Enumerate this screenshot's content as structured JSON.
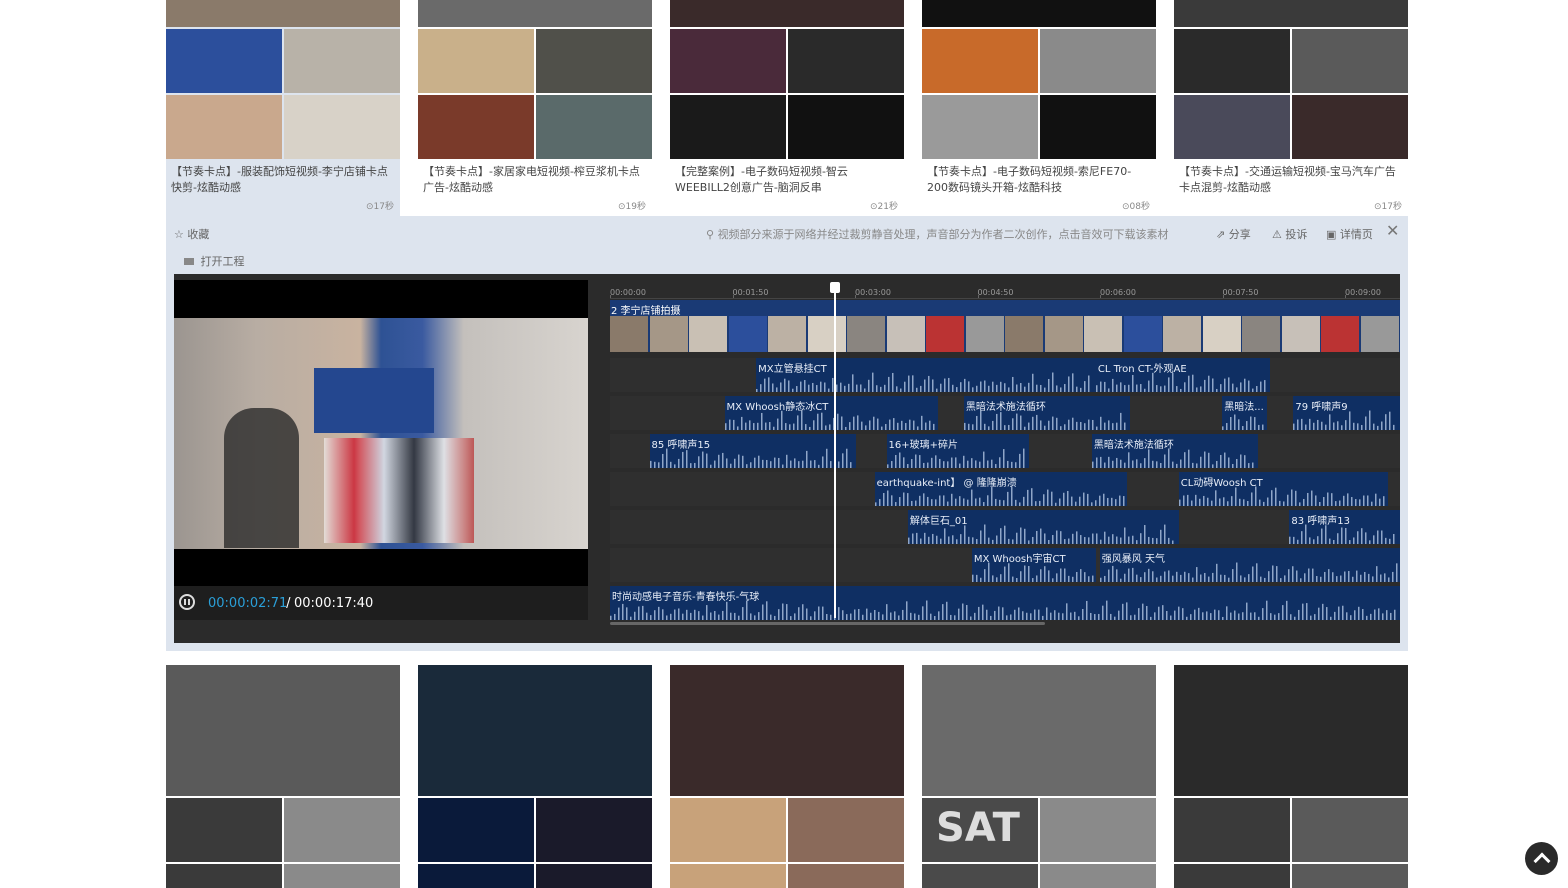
{
  "top_cards": [
    {
      "title": "【节奏卡点】-服装配饰短视频-李宁店铺卡点快剪-炫酷动感",
      "duration": "⊙17秒",
      "colors": [
        "#8a7a6a",
        "#2c4f9c",
        "#b8b2a8",
        "#c9a88d",
        "#d8d2c8"
      ]
    },
    {
      "title": "【节奏卡点】-家居家电短视频-榨豆浆机卡点广告-炫酷动感",
      "duration": "⊙19秒",
      "colors": [
        "#6a6a6a",
        "#c9b08a",
        "#50504a",
        "#7a3a2a",
        "#5a6a6a"
      ]
    },
    {
      "title": "【完整案例】-电子数码短视频-智云WEEBILL2创意广告-脑洞反串",
      "duration": "⊙21秒",
      "colors": [
        "#3a2a2a",
        "#4a2a3a",
        "#2a2a2a",
        "#1a1a1a",
        "#111111"
      ]
    },
    {
      "title": "【节奏卡点】-电子数码短视频-索尼FE70-200数码镜头开箱-炫酷科技",
      "duration": "⊙08秒",
      "colors": [
        "#111111",
        "#c86a2a",
        "#8a8a8a",
        "#9a9a9a",
        "#111111"
      ]
    },
    {
      "title": "【节奏卡点】-交通运输短视频-宝马汽车广告卡点混剪-炫酷动感",
      "duration": "⊙17秒",
      "colors": [
        "#3a3a3a",
        "#2a2a2a",
        "#5a5a5a",
        "#4a4a5a",
        "#3a2a2a"
      ]
    }
  ],
  "panel": {
    "favorite": "收藏",
    "open_project": "打开工程",
    "notice": "视频部分来源于网络并经过裁剪静音处理，声音部分为作者二次创作，点击音效可下载该素材",
    "share": "分享",
    "report": "投诉",
    "details": "详情页",
    "close": "✕"
  },
  "player": {
    "current_time": "00:00:02:71",
    "separator": " / ",
    "total_time": "00:00:17:40"
  },
  "timeline": {
    "ticks": [
      "00:00:00",
      "00:01:50",
      "00:03:00",
      "00:04:50",
      "00:06:00",
      "00:07:50",
      "00:09:00"
    ],
    "playhead": 0.284,
    "video_clip": "2 李宁店铺拍摄",
    "lanes": [
      [
        {
          "label": "MX立管悬挂CT",
          "start": 0.185,
          "end": 0.615
        },
        {
          "label": "CL Tron CT-外观AE",
          "start": 0.615,
          "end": 0.835
        }
      ],
      [
        {
          "label": "MX Whoosh静态冰CT",
          "start": 0.145,
          "end": 0.415
        },
        {
          "label": "黑暗法术施法循环",
          "start": 0.448,
          "end": 0.658
        },
        {
          "label": "黑暗法...",
          "start": 0.775,
          "end": 0.832
        },
        {
          "label": "79 呼啸声9",
          "start": 0.865,
          "end": 1.0
        }
      ],
      [
        {
          "label": "85 呼啸声15",
          "start": 0.05,
          "end": 0.312
        },
        {
          "label": "16+玻璃+碎片",
          "start": 0.35,
          "end": 0.53
        },
        {
          "label": "黑暗法术施法循环",
          "start": 0.61,
          "end": 0.82
        }
      ],
      [
        {
          "label": "earthquake-int】 @ 隆隆崩溃",
          "start": 0.335,
          "end": 0.655
        },
        {
          "label": "CL动碍Woosh CT",
          "start": 0.72,
          "end": 0.985
        }
      ],
      [
        {
          "label": "解体巨石_01",
          "start": 0.377,
          "end": 0.72
        },
        {
          "label": "83 呼啸声13",
          "start": 0.86,
          "end": 1.0
        }
      ],
      [
        {
          "label": "MX Whoosh宇宙CT",
          "start": 0.458,
          "end": 0.615
        },
        {
          "label": "强风暴风 天气",
          "start": 0.62,
          "end": 1.0
        }
      ],
      [
        {
          "label": "时尚动感电子音乐-青春快乐-气球",
          "start": 0.0,
          "end": 1.0
        }
      ]
    ]
  },
  "bottom_cards": [
    {
      "colors": [
        "#5a5a5a",
        "#3a3a3a",
        "#8a8a8a"
      ]
    },
    {
      "colors": [
        "#1a2a3a",
        "#0a1a3a",
        "#1a1a2a"
      ]
    },
    {
      "colors": [
        "#3a2a2a",
        "#c8a27a",
        "#8a6a5a"
      ]
    },
    {
      "colors": [
        "#6a6a6a",
        "#4a4a4a",
        "#8a8a8a"
      ]
    },
    {
      "colors": [
        "#2a2a2a",
        "#3a3a3a",
        "#5a5a5a"
      ]
    }
  ],
  "bottom_card_text": {
    "sat": "SAT"
  },
  "scroll_top_icon": "chevron-up-icon"
}
